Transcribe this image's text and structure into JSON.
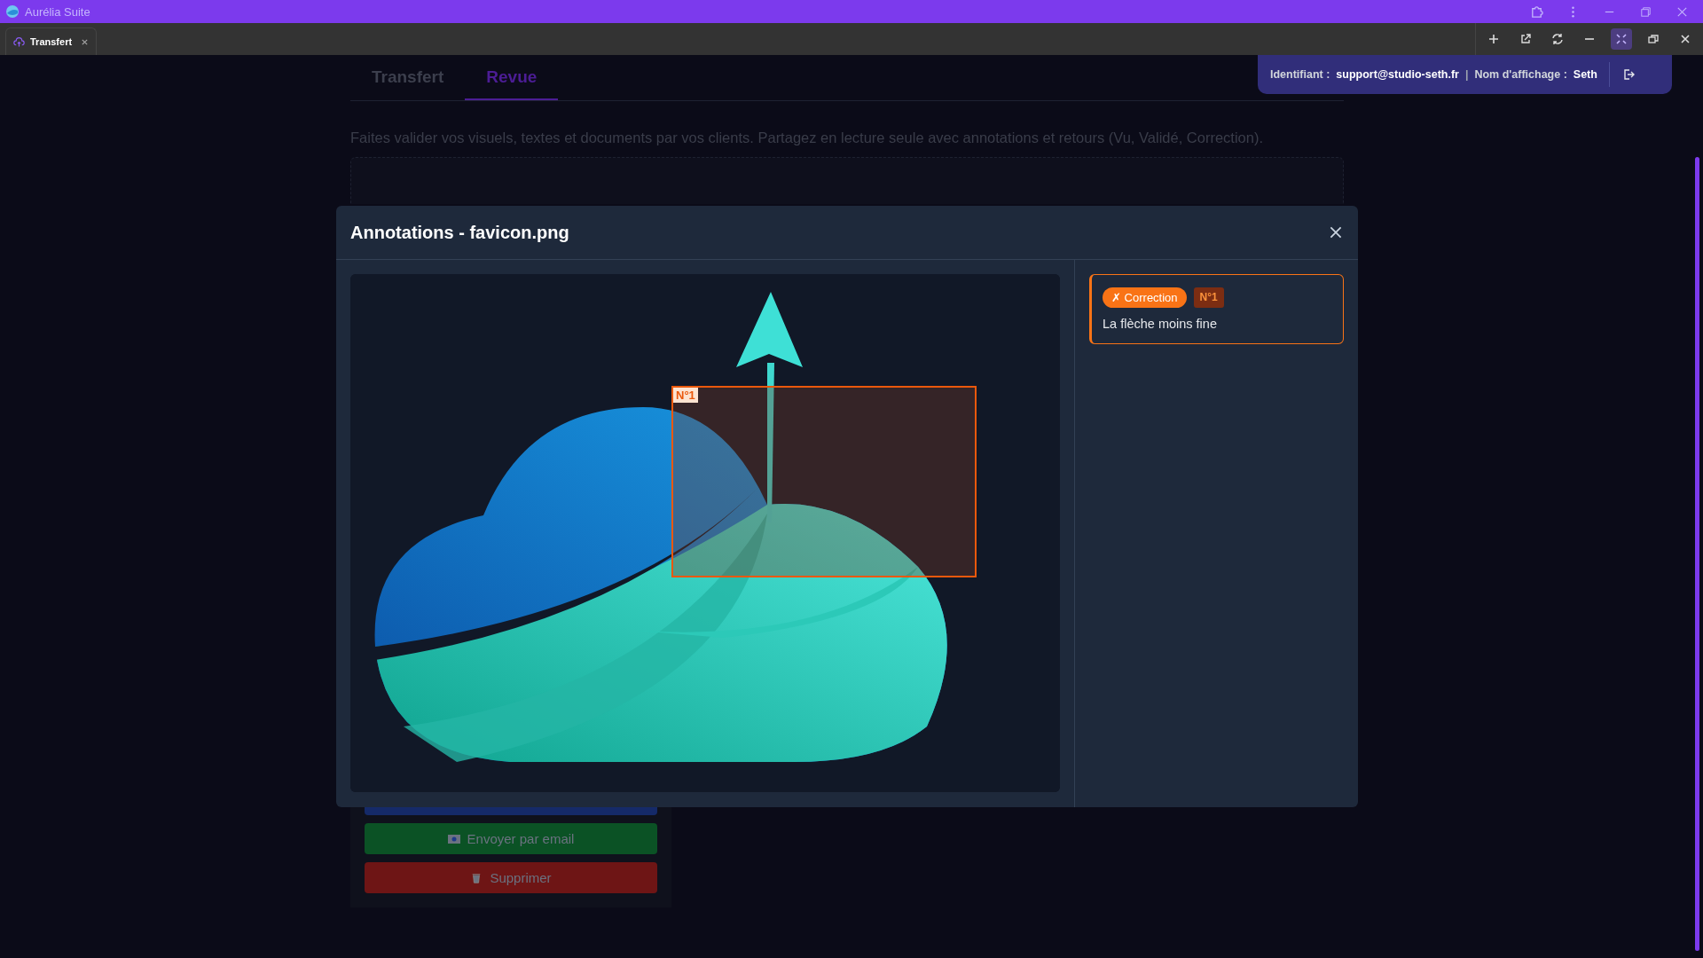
{
  "app": {
    "title": "Aurélia Suite"
  },
  "browser_tabs": [
    {
      "label": "Transfert",
      "selected": true
    }
  ],
  "tabs": [
    {
      "label": "Transfert",
      "selected": false
    },
    {
      "label": "Revue",
      "selected": true
    }
  ],
  "identity": {
    "id_label": "Identifiant :",
    "id_value": "support@studio-seth.fr",
    "separator": "|",
    "name_label": "Nom d'affichage :",
    "name_value": "Seth"
  },
  "description": "Faites valider vos visuels, textes et documents par vos clients. Partagez en lecture seule avec annotations et retours (Vu, Validé, Correction).",
  "actions": [
    {
      "kind": "primary"
    },
    {
      "kind": "email",
      "label": "Envoyer par email"
    },
    {
      "kind": "delete",
      "label": "Supprimer"
    }
  ],
  "modal": {
    "title": "Annotations - favicon.png",
    "markers": [
      {
        "label": "N°1"
      }
    ],
    "annotations": [
      {
        "status": "✗ Correction",
        "kind": "correction",
        "number": "N°1",
        "text": "La flèche moins fine"
      }
    ]
  }
}
